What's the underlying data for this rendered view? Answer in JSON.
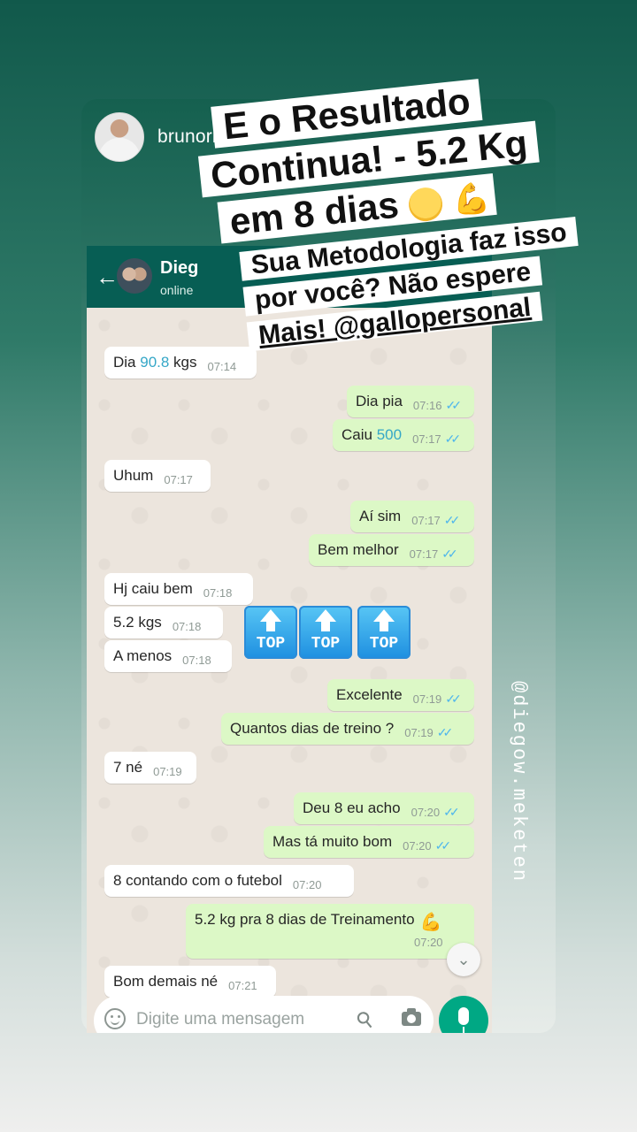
{
  "story": {
    "username": "brunorigoni",
    "side_handle": "@diegow.meketen"
  },
  "overlay": {
    "title_lines": [
      "E o Resultado",
      "Continua! - 5.2 Kg",
      "em 8 dias"
    ],
    "title_icons": [
      "worried-face-icon",
      "flexed-biceps-icon"
    ],
    "subtitle_lines": [
      "Sua Metodologia faz isso",
      "por você? Não espere",
      "Mais! @gallopersonal"
    ]
  },
  "whatsapp": {
    "contact_name": "Dieg",
    "contact_status": "online",
    "input_placeholder": "Digite uma mensagem",
    "messages": [
      {
        "dir": "in",
        "text_pre": "Dia ",
        "text_hl": "90.8",
        "text_post": " kgs",
        "time": "07:14"
      },
      {
        "dir": "out",
        "text": "Dia pia",
        "time": "07:16"
      },
      {
        "dir": "out",
        "text_pre": "Caiu ",
        "text_hl": "500",
        "time": "07:17"
      },
      {
        "dir": "in",
        "text": "Uhum",
        "time": "07:17"
      },
      {
        "dir": "out",
        "text": "Aí sim",
        "time": "07:17"
      },
      {
        "dir": "out",
        "text": "Bem melhor",
        "time": "07:17"
      },
      {
        "dir": "in",
        "text": "Hj caiu bem",
        "time": "07:18"
      },
      {
        "dir": "in",
        "text": "5.2 kgs",
        "time": "07:18"
      },
      {
        "dir": "in",
        "text": "A menos",
        "time": "07:18"
      },
      {
        "dir": "out",
        "text": "Excelente",
        "time": "07:19"
      },
      {
        "dir": "out",
        "text": "Quantos dias de treino ?",
        "time": "07:19"
      },
      {
        "dir": "in",
        "text": "7 né",
        "time": "07:19"
      },
      {
        "dir": "out",
        "text": "Deu 8 eu acho",
        "time": "07:20"
      },
      {
        "dir": "out",
        "text": "Mas tá muito bom",
        "time": "07:20"
      },
      {
        "dir": "in",
        "text": "8 contando com o futebol",
        "time": "07:20"
      },
      {
        "dir": "out",
        "text": "5.2 kg pra 8 dias de Treinamento",
        "time": "07:20"
      },
      {
        "dir": "in",
        "text": "Bom demais né",
        "time": "07:21"
      }
    ],
    "top_emojis": [
      "TOP",
      "TOP",
      "TOP"
    ],
    "colors": {
      "header": "#075e54",
      "outgoing": "#dcf8c6",
      "incoming": "#ffffff",
      "ticks": "#4fb6ec",
      "mic": "#00a884"
    }
  }
}
